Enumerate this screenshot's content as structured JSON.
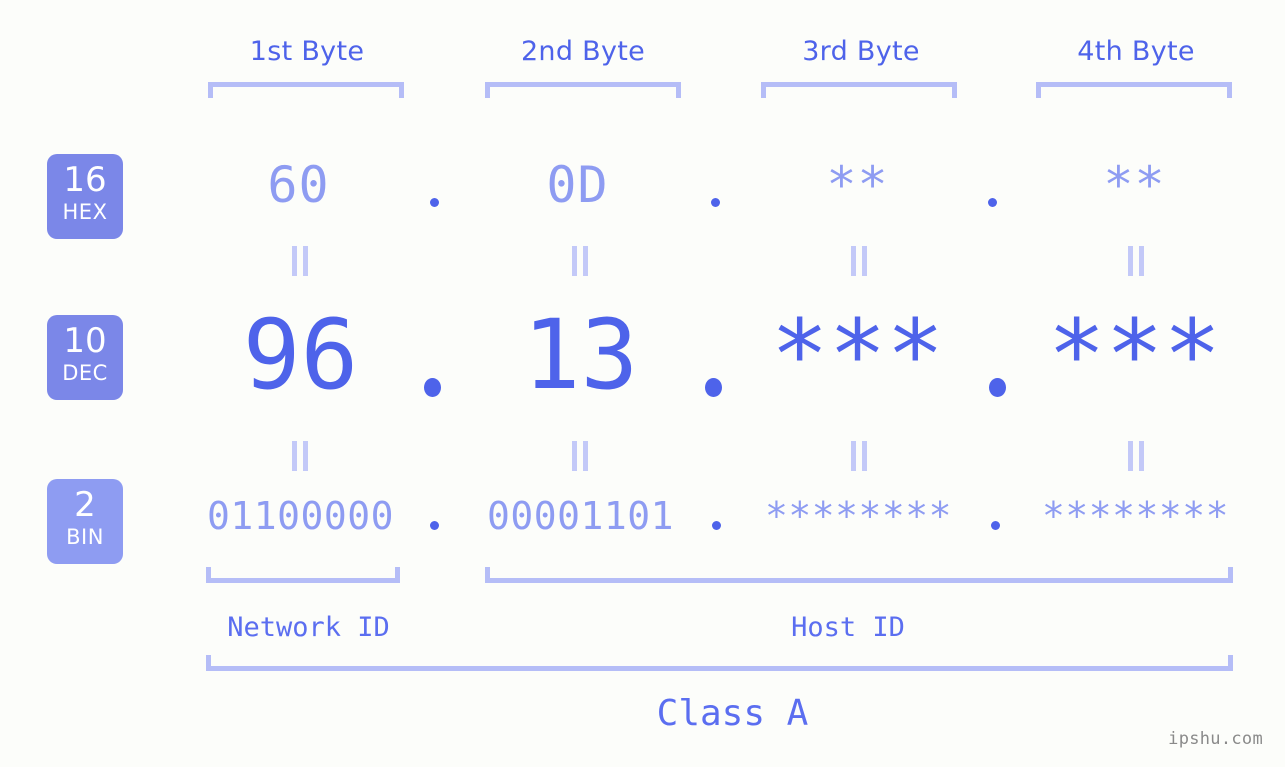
{
  "meta": {
    "watermark": "ipshu.com",
    "background_color": "#fcfdfa",
    "accent_strong": "#4e63ea",
    "accent_light": "#8e9cf2",
    "accent_pale": "#b5bdf7",
    "badge_color": "#7b87e8",
    "badge_color_bin": "#8e9cf2"
  },
  "headers": {
    "byte1": "1st Byte",
    "byte2": "2nd Byte",
    "byte3": "3rd Byte",
    "byte4": "4th Byte"
  },
  "bases": [
    {
      "number": "16",
      "label": "HEX"
    },
    {
      "number": "10",
      "label": "DEC"
    },
    {
      "number": "2",
      "label": "BIN"
    }
  ],
  "rows": {
    "hex": {
      "base_number": "16",
      "base_label": "HEX",
      "values": [
        "60",
        "0D",
        "**",
        "**"
      ],
      "separators": [
        ".",
        ".",
        "."
      ]
    },
    "dec": {
      "base_number": "10",
      "base_label": "DEC",
      "values": [
        "96",
        "13",
        "***",
        "***"
      ],
      "separators": [
        ".",
        ".",
        "."
      ]
    },
    "bin": {
      "base_number": "2",
      "base_label": "BIN",
      "values": [
        "01100000",
        "00001101",
        "********",
        "********"
      ],
      "separators": [
        ".",
        ".",
        "."
      ]
    }
  },
  "equals_marks": {
    "symbol": "=",
    "count_per_row": 4,
    "rows": 2
  },
  "footer": {
    "network_id_label": "Network ID",
    "host_id_label": "Host ID",
    "class_label": "Class A"
  }
}
